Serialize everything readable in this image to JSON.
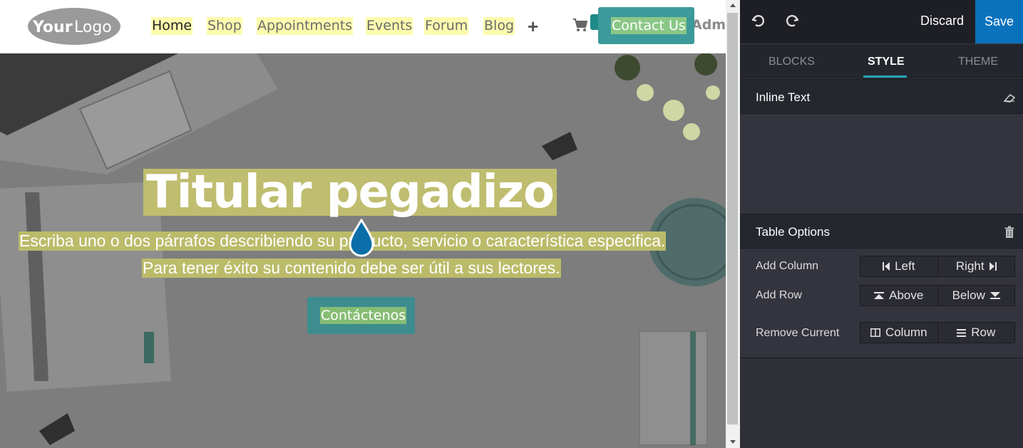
{
  "site": {
    "logo_text": "YourLogo",
    "nav": [
      {
        "label": "Home"
      },
      {
        "label": "Shop"
      },
      {
        "label": "Appointments"
      },
      {
        "label": "Events"
      },
      {
        "label": "Forum"
      },
      {
        "label": "Blog"
      }
    ],
    "contact_label": "Contact Us",
    "admin_label": "Admi",
    "hero": {
      "title": "Titular pegadizo",
      "line1": "Escriba uno o dos párrafos describiendo su producto, servicio o característica especifica.",
      "line2": "Para tener éxito su contenido debe ser útil a sus lectores.",
      "cta": "Contáctenos"
    }
  },
  "editor": {
    "discard_label": "Discard",
    "save_label": "Save",
    "tabs": [
      {
        "label": "BLOCKS",
        "active": false
      },
      {
        "label": "STYLE",
        "active": true
      },
      {
        "label": "THEME",
        "active": false
      }
    ],
    "inline_text": {
      "title": "Inline Text"
    },
    "table_options": {
      "title": "Table Options",
      "add_column": {
        "label": "Add Column",
        "left": "Left",
        "right": "Right"
      },
      "add_row": {
        "label": "Add Row",
        "above": "Above",
        "below": "Below"
      },
      "remove_current": {
        "label": "Remove Current",
        "column": "Column",
        "row": "Row"
      }
    }
  },
  "colors": {
    "highlight": "#fdfcae",
    "accent_teal": "#3c9a9a",
    "save_blue": "#0a72bd",
    "tab_underline": "#23a6bd"
  }
}
